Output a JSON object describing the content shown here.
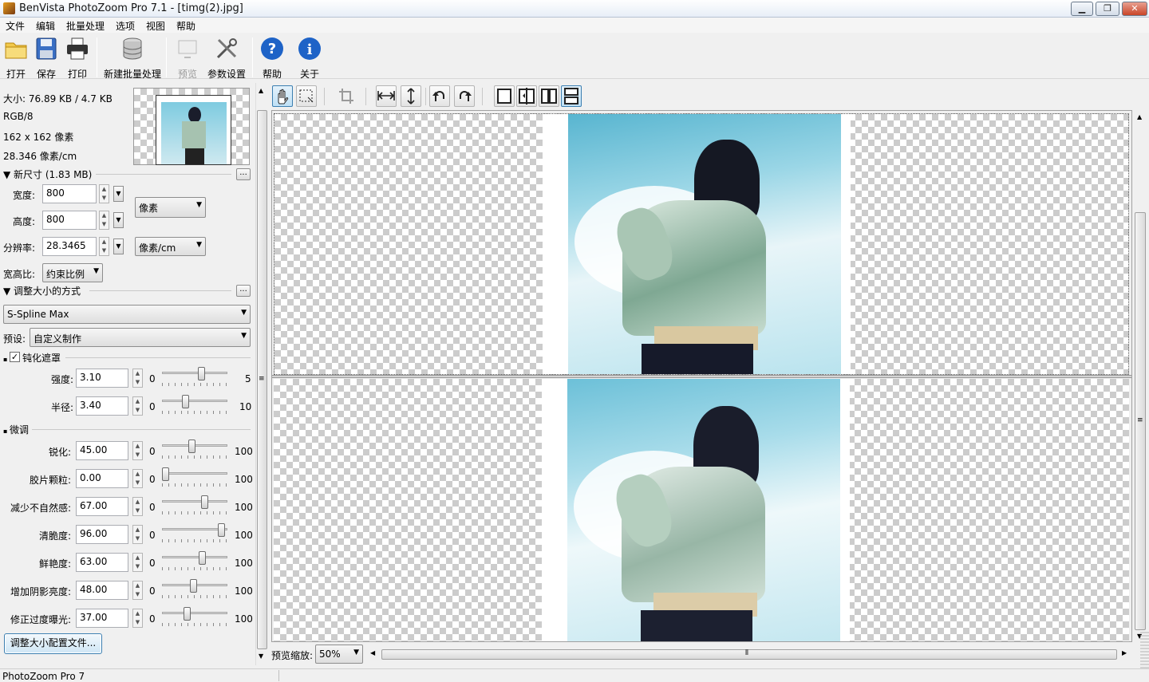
{
  "window": {
    "title": "BenVista PhotoZoom Pro 7.1 - [timg(2).jpg]",
    "minimize": "▁",
    "maximize": "❐",
    "close": "✕"
  },
  "menu": [
    "文件",
    "编辑",
    "批量处理",
    "选项",
    "视图",
    "帮助"
  ],
  "toolbar": {
    "open": "打开",
    "save": "保存",
    "print": "打印",
    "new_batch": "新建批量处理",
    "preview": "预览",
    "settings": "参数设置",
    "help": "帮助",
    "about": "关于"
  },
  "info": {
    "size": "大小: 76.89 KB / 4.7 KB",
    "mode": "RGB/8",
    "dims": "162 x 162 像素",
    "res": "28.346 像素/cm"
  },
  "new_size": {
    "header": "▼ 新尺寸 (1.83 MB)",
    "width_label": "宽度:",
    "width": "800",
    "height_label": "高度:",
    "height": "800",
    "res_label": "分辨率:",
    "res": "28.3465",
    "px_unit": "像素",
    "res_unit": "像素/cm",
    "aspect_label": "宽高比:",
    "aspect": "约束比例"
  },
  "resize_method": {
    "header": "▼ 调整大小的方式",
    "method": "S-Spline Max",
    "preset_label": "预设:",
    "preset": "自定义制作"
  },
  "unsharp": {
    "label": "钝化遮罩",
    "checked": true,
    "strength_label": "强度:",
    "strength": "3.10",
    "strength_min": "0",
    "strength_max": "5",
    "strength_level": 0.62,
    "radius_label": "半径:",
    "radius": "3.40",
    "radius_min": "0",
    "radius_max": "10",
    "radius_level": 0.34
  },
  "finetune": {
    "header": "微调",
    "items": [
      {
        "label": "锐化:",
        "value": "45.00",
        "min": "0",
        "max": "100",
        "level": 0.45
      },
      {
        "label": "胶片颗粒:",
        "value": "0.00",
        "min": "0",
        "max": "100",
        "level": 0.0
      },
      {
        "label": "减少不自然感:",
        "value": "67.00",
        "min": "0",
        "max": "100",
        "level": 0.67
      },
      {
        "label": "清脆度:",
        "value": "96.00",
        "min": "0",
        "max": "100",
        "level": 0.96
      },
      {
        "label": "鲜艳度:",
        "value": "63.00",
        "min": "0",
        "max": "100",
        "level": 0.63
      },
      {
        "label": "增加阴影亮度:",
        "value": "48.00",
        "min": "0",
        "max": "100",
        "level": 0.48
      },
      {
        "label": "修正过度曝光:",
        "value": "37.00",
        "min": "0",
        "max": "100",
        "level": 0.37
      }
    ]
  },
  "profile_button": "调整大小配置文件...",
  "preview": {
    "zoom_label": "预览缩放:",
    "zoom": "50%"
  },
  "status": "PhotoZoom Pro 7",
  "colors": {
    "accent": "#3c7fb1",
    "sky": "#8ccfe0",
    "jacket": "#9bbfa8"
  }
}
